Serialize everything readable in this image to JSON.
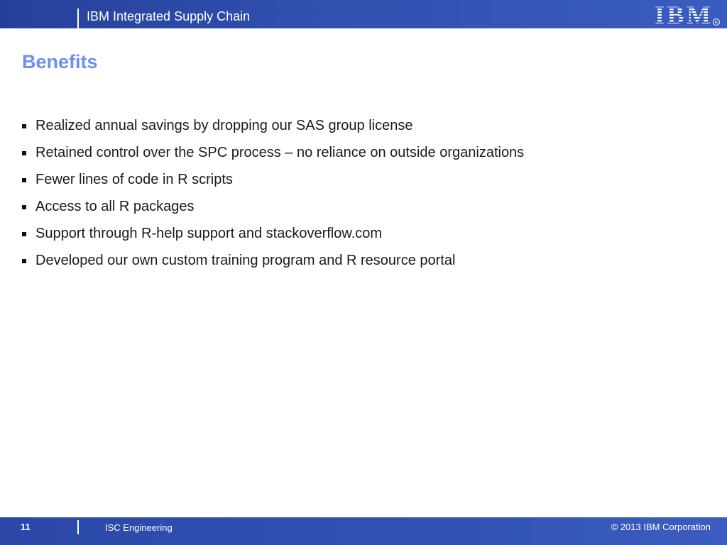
{
  "header": {
    "title": "IBM Integrated Supply Chain",
    "logo_text": "IBM"
  },
  "slide": {
    "title": "Benefits",
    "bullets": [
      "Realized annual savings by dropping our SAS group license",
      "Retained control over the SPC process – no reliance on outside organizations",
      "Fewer lines of code in R scripts",
      "Access to all R packages",
      "Support through R-help support and stackoverflow.com",
      "Developed our own custom training program and R resource portal"
    ]
  },
  "footer": {
    "page_number": "11",
    "label": "ISC Engineering",
    "copyright": "© 2013 IBM Corporation"
  },
  "colors": {
    "header_bar": "#3150b0",
    "title": "#6e8ef0",
    "body_text": "#1a1a1a"
  }
}
